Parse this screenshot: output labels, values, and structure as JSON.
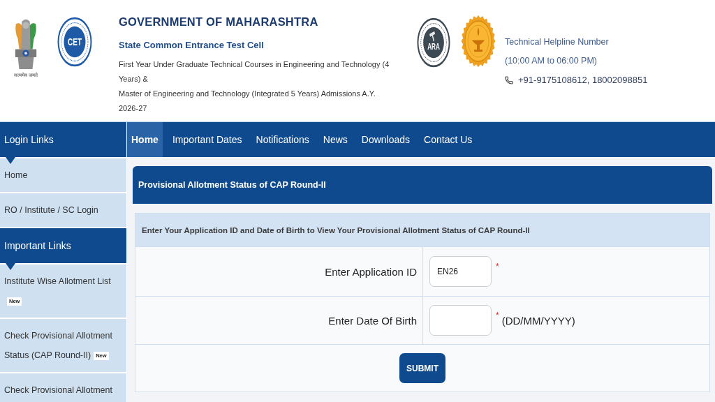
{
  "header": {
    "emblem": {
      "motto": "सत्यमेव जयते"
    },
    "cet_logo": {
      "letters": "CET"
    },
    "title": "GOVERNMENT OF MAHARASHTRA",
    "subtitle": "State Common Entrance Test Cell",
    "description": [
      "First Year Under Graduate Technical Courses in Engineering and Technology (4 Years) &",
      "Master of Engineering and Technology (Integrated 5 Years) Admissions A.Y. 2026-27"
    ],
    "ara_logo": {
      "letters": "ARA"
    },
    "helpline": {
      "title": "Technical Helpline Number",
      "hours": "(10:00 AM to 06:00 PM)",
      "phones": "+91-9175108612, 18002098851"
    }
  },
  "sidebar": {
    "sections": [
      {
        "heading": "Login Links",
        "items": [
          {
            "label": "Home"
          },
          {
            "label": "RO / Institute / SC Login"
          }
        ]
      },
      {
        "heading": "Important Links",
        "items": [
          {
            "label": "Institute Wise Allotment List",
            "badge": "New"
          },
          {
            "label": "Check Provisional Allotment Status (CAP Round-II)",
            "badge": "New"
          },
          {
            "label": "Check Provisional Allotment"
          }
        ]
      }
    ]
  },
  "nav": {
    "tabs": [
      {
        "label": "Home",
        "selected": true
      },
      {
        "label": "Important Dates",
        "selected": false
      },
      {
        "label": "Notifications",
        "selected": false
      },
      {
        "label": "News",
        "selected": false
      },
      {
        "label": "Downloads",
        "selected": false
      },
      {
        "label": "Contact Us",
        "selected": false
      }
    ]
  },
  "panel": {
    "title": "Provisional Allotment Status of CAP Round-II",
    "instruction": "Enter Your Application ID and Date of Birth to View Your Provisional Allotment Status of CAP Round-II",
    "fields": [
      {
        "label": "Enter Application ID",
        "value": "EN26",
        "required_mark": "*"
      },
      {
        "label": "Enter Date Of Birth",
        "required_mark": "*",
        "hint": "(DD/MM/YYYY)"
      }
    ],
    "submit": "SUBMIT"
  }
}
